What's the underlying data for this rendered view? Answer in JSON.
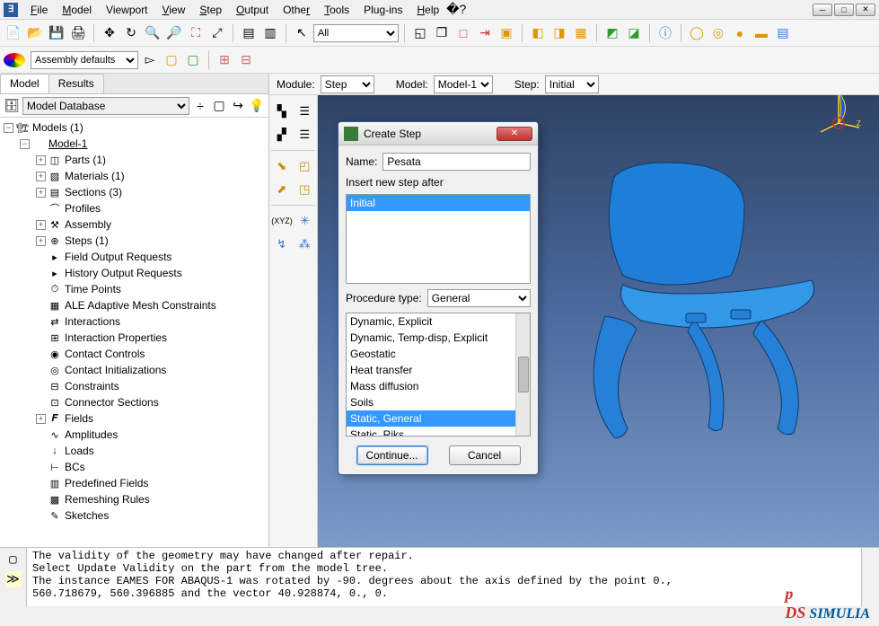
{
  "menu": [
    "File",
    "Model",
    "Viewport",
    "View",
    "Step",
    "Output",
    "Other",
    "Tools",
    "Plug-ins",
    "Help"
  ],
  "toolbar2": {
    "assembly_select": "Assembly defaults",
    "filter_select": "All"
  },
  "context": {
    "module_label": "Module:",
    "module_value": "Step",
    "model_label": "Model:",
    "model_value": "Model-1",
    "step_label": "Step:",
    "step_value": "Initial"
  },
  "left_tabs": {
    "model": "Model",
    "results": "Results"
  },
  "tree_db_select": "Model Database",
  "tree": {
    "models": "Models (1)",
    "model1": "Model-1",
    "parts": "Parts (1)",
    "materials": "Materials (1)",
    "sections": "Sections (3)",
    "profiles": "Profiles",
    "assembly": "Assembly",
    "steps": "Steps (1)",
    "field_out": "Field Output Requests",
    "hist_out": "History Output Requests",
    "time_points": "Time Points",
    "ale": "ALE Adaptive Mesh Constraints",
    "interactions": "Interactions",
    "int_props": "Interaction Properties",
    "contact_ctrls": "Contact Controls",
    "contact_init": "Contact Initializations",
    "constraints": "Constraints",
    "conn_sect": "Connector Sections",
    "fields": "Fields",
    "amplitudes": "Amplitudes",
    "loads": "Loads",
    "bcs": "BCs",
    "predef": "Predefined Fields",
    "remesh": "Remeshing Rules",
    "sketches": "Sketches"
  },
  "dialog": {
    "title": "Create Step",
    "name_label": "Name:",
    "name_value": "Pesata",
    "insert_label": "Insert new step after",
    "insert_items": [
      "Initial"
    ],
    "insert_selected": 0,
    "proc_label": "Procedure type:",
    "proc_value": "General",
    "proc_items": [
      "Dynamic, Explicit",
      "Dynamic, Temp-disp, Explicit",
      "Geostatic",
      "Heat transfer",
      "Mass diffusion",
      "Soils",
      "Static, General",
      "Static, Riks"
    ],
    "proc_selected": 6,
    "continue": "Continue...",
    "cancel": "Cancel"
  },
  "console_lines": [
    "The validity of the geometry may have changed after repair.",
    "Select Update Validity on the part from the model tree.",
    "The instance EAMES FOR ABAQUS-1 was rotated by -90. degrees about the axis defined by the point 0.,",
    "560.718679, 560.396885 and the vector 40.928874, 0., 0."
  ],
  "simulia": "SIMULIA"
}
